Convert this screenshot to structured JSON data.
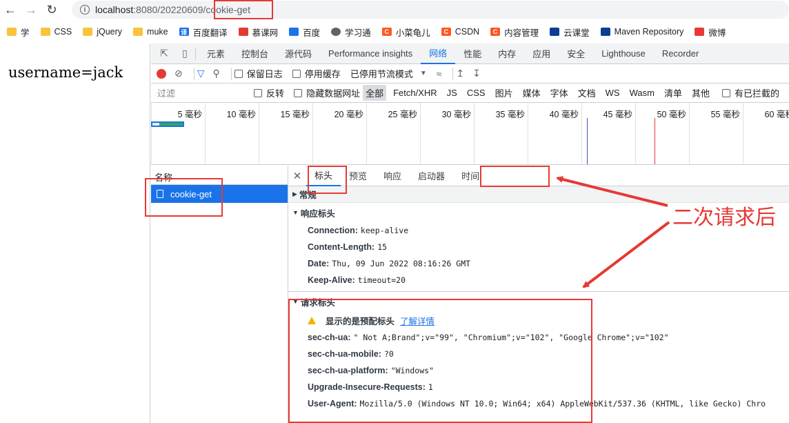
{
  "address": {
    "host": "localhost",
    "path_prefix": ":8080/20220609/",
    "path_highlight": "cookie-get"
  },
  "bookmarks": [
    {
      "label": "学",
      "icon": "folder-icon"
    },
    {
      "label": "CSS",
      "icon": "folder-icon"
    },
    {
      "label": "jQuery",
      "icon": "folder-icon"
    },
    {
      "label": "muke",
      "icon": "folder-icon"
    },
    {
      "label": "百度翻译",
      "icon": "translate-icon"
    },
    {
      "label": "慕课网",
      "icon": "flame-icon"
    },
    {
      "label": "百度",
      "icon": "paw-icon"
    },
    {
      "label": "学习通",
      "icon": "globe-icon"
    },
    {
      "label": "小菜龟儿",
      "icon": "csdn-icon"
    },
    {
      "label": "CSDN",
      "icon": "csdn-icon"
    },
    {
      "label": "内容管理",
      "icon": "csdn-icon"
    },
    {
      "label": "云课堂",
      "icon": "etc-icon"
    },
    {
      "label": "Maven Repository",
      "icon": "mvn-icon"
    },
    {
      "label": "微博",
      "icon": "weibo-icon"
    }
  ],
  "page": {
    "text": "username=jack"
  },
  "devtools": {
    "tabs": [
      "元素",
      "控制台",
      "源代码",
      "Performance insights",
      "网络",
      "性能",
      "内存",
      "应用",
      "安全",
      "Lighthouse",
      "Recorder"
    ],
    "active_tab": "网络",
    "toolbar": {
      "preserve_log": "保留日志",
      "disable_cache": "停用缓存",
      "throttle": "已停用节流模式"
    },
    "filter": {
      "placeholder": "过滤",
      "invert": "反转",
      "hide_data_urls": "隐藏数据网址",
      "types": [
        "全部",
        "Fetch/XHR",
        "JS",
        "CSS",
        "图片",
        "媒体",
        "字体",
        "文档",
        "WS",
        "Wasm",
        "清单",
        "其他"
      ],
      "active_type": "全部",
      "blocked_cookies": "有已拦截的"
    },
    "timeline_ticks": [
      "5 毫秒",
      "10 毫秒",
      "15 毫秒",
      "20 毫秒",
      "25 毫秒",
      "30 毫秒",
      "35 毫秒",
      "40 毫秒",
      "45 毫秒",
      "50 毫秒",
      "55 毫秒",
      "60 毫秒"
    ],
    "request_list": {
      "header": "名称",
      "rows": [
        "cookie-get"
      ]
    },
    "detail_tabs": [
      "标头",
      "预览",
      "响应",
      "启动器",
      "时间"
    ],
    "active_detail_tab": "标头",
    "sections": {
      "general": "常规",
      "response_headers_title": "响应标头",
      "response_headers": [
        {
          "key": "Connection:",
          "value": "keep-alive"
        },
        {
          "key": "Content-Length:",
          "value": "15"
        },
        {
          "key": "Date:",
          "value": "Thu, 09 Jun 2022 08:16:26 GMT"
        },
        {
          "key": "Keep-Alive:",
          "value": "timeout=20"
        }
      ],
      "request_headers_title": "请求标头",
      "provisional_warning": "显示的是预配标头",
      "learn_more": "了解详情",
      "request_headers": [
        {
          "key": "sec-ch-ua:",
          "value": "\" Not A;Brand\";v=\"99\", \"Chromium\";v=\"102\", \"Google Chrome\";v=\"102\""
        },
        {
          "key": "sec-ch-ua-mobile:",
          "value": "?0"
        },
        {
          "key": "sec-ch-ua-platform:",
          "value": "\"Windows\""
        },
        {
          "key": "Upgrade-Insecure-Requests:",
          "value": "1"
        },
        {
          "key": "User-Agent:",
          "value": "Mozilla/5.0 (Windows NT 10.0; Win64; x64) AppleWebKit/537.36 (KHTML, like Gecko) Chro"
        }
      ]
    }
  },
  "annotation": {
    "text": "二次请求后",
    "color": "#e53935"
  }
}
